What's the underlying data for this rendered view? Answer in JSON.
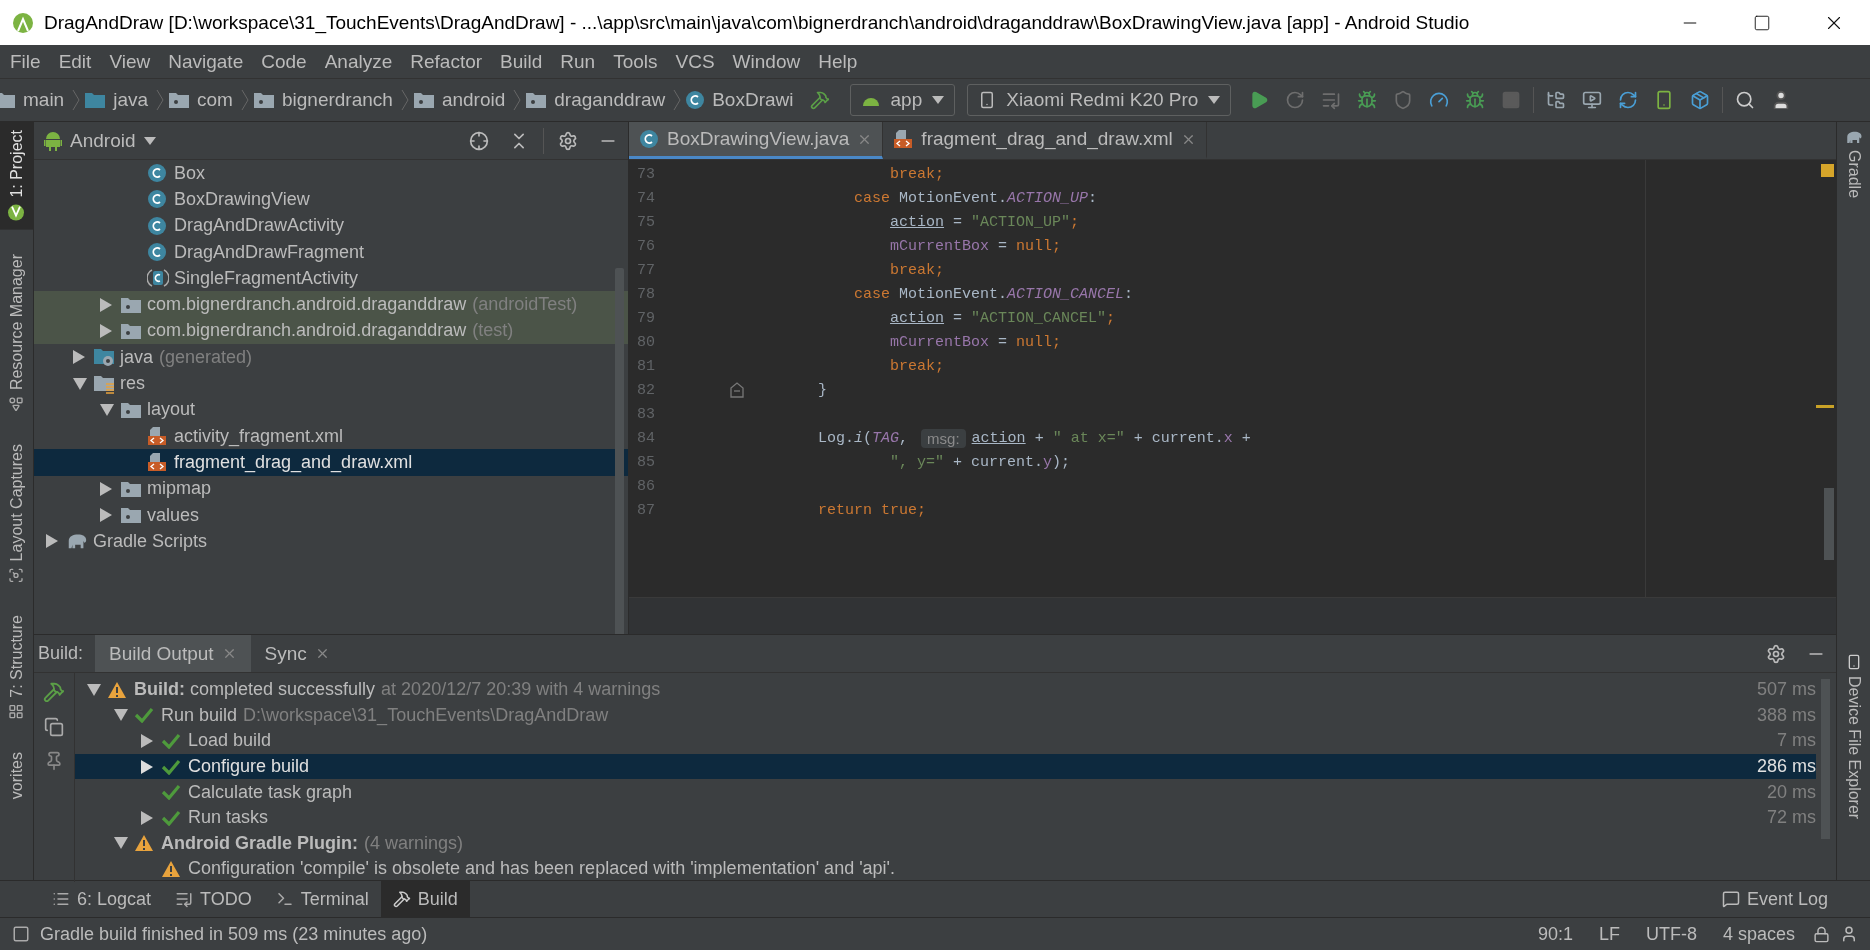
{
  "window": {
    "title": "DragAndDraw [D:\\workspace\\31_TouchEvents\\DragAndDraw] - ...\\app\\src\\main\\java\\com\\bignerdranch\\android\\draganddraw\\BoxDrawingView.java [app] - Android Studio"
  },
  "menu": [
    "File",
    "Edit",
    "View",
    "Navigate",
    "Code",
    "Analyze",
    "Refactor",
    "Build",
    "Run",
    "Tools",
    "VCS",
    "Window",
    "Help"
  ],
  "breadcrumbs": [
    {
      "label": "main",
      "kind": "folder"
    },
    {
      "label": "java",
      "kind": "source-folder"
    },
    {
      "label": "com",
      "kind": "package"
    },
    {
      "label": "bignerdranch",
      "kind": "package"
    },
    {
      "label": "android",
      "kind": "package"
    },
    {
      "label": "draganddraw",
      "kind": "package"
    },
    {
      "label": "BoxDrawi",
      "kind": "class"
    }
  ],
  "toolbar": {
    "run_config": "app",
    "device": "Xiaomi Redmi K20 Pro"
  },
  "left_tool_tabs": [
    {
      "label": "1: Project",
      "kind": "project",
      "selected": true
    },
    {
      "label": "Resource Manager",
      "kind": "resources",
      "selected": false
    },
    {
      "label": "Layout Captures",
      "kind": "captures",
      "selected": false
    },
    {
      "label": "7: Structure",
      "kind": "structure",
      "selected": false
    },
    {
      "label": "vorites",
      "kind": "favorites",
      "selected": false
    }
  ],
  "right_tool_tabs": [
    {
      "label": "Gradle",
      "kind": "gradle"
    },
    {
      "label": "Device File Explorer",
      "kind": "device"
    }
  ],
  "project": {
    "view": "Android",
    "tree": [
      {
        "children": [
          {
            "children": [
              {
                "children": [
                  {
                    "label": "Box",
                    "kind": "class",
                    "selected": false
                  },
                  {
                    "label": "BoxDrawingView",
                    "kind": "class",
                    "selected": false
                  },
                  {
                    "label": "DragAndDrawActivity",
                    "kind": "class",
                    "selected": false
                  },
                  {
                    "label": "DragAndDrawFragment",
                    "kind": "class",
                    "selected": false
                  },
                  {
                    "label": "SingleFragmentActivity",
                    "kind": "abstract-class",
                    "selected": false
                  }
                ]
              },
              {
                "label": "com.bignerdranch.android.draganddraw",
                "note": "(androidTest)",
                "kind": "package",
                "expanded": false,
                "test": true,
                "selected": false
              },
              {
                "label": "com.bignerdranch.android.draganddraw",
                "note": "(test)",
                "kind": "package",
                "expanded": false,
                "test": true,
                "selected": false
              }
            ]
          },
          {
            "label": "java",
            "note": "(generated)",
            "kind": "generated-folder",
            "expanded": false,
            "selected": false
          },
          {
            "label": "res",
            "kind": "res-folder",
            "expanded": true,
            "selected": false,
            "children": [
              {
                "label": "layout",
                "kind": "package",
                "expanded": true,
                "selected": false,
                "children": [
                  {
                    "label": "activity_fragment.xml",
                    "kind": "layout-file",
                    "selected": false
                  },
                  {
                    "label": "fragment_drag_and_draw.xml",
                    "kind": "layout-file",
                    "selected": true
                  }
                ]
              },
              {
                "label": "mipmap",
                "kind": "package",
                "expanded": false,
                "selected": false
              },
              {
                "label": "values",
                "kind": "package",
                "expanded": false,
                "selected": false
              }
            ]
          }
        ]
      },
      {
        "label": "Gradle Scripts",
        "kind": "gradle",
        "expanded": false,
        "selected": false
      }
    ]
  },
  "editor": {
    "tabs": [
      {
        "label": "BoxDrawingView.java",
        "kind": "class",
        "selected": true
      },
      {
        "label": "fragment_drag_and_draw.xml",
        "kind": "layout-file",
        "selected": false
      }
    ],
    "lines": [
      {
        "number": "73",
        "tokens": [
          {
            "kind": "keyword",
            "text": "            break;"
          }
        ]
      },
      {
        "number": "74",
        "tokens": [
          {
            "kind": "keyword",
            "text": "        case"
          },
          {
            "kind": "plain",
            "text": " MotionEvent."
          },
          {
            "kind": "constant",
            "text": "ACTION_UP"
          },
          {
            "kind": "plain",
            "text": ":"
          }
        ]
      },
      {
        "number": "75",
        "tokens": [
          {
            "kind": "variable",
            "text": "            action"
          },
          {
            "kind": "plain",
            "text": " = "
          },
          {
            "kind": "string",
            "text": "\"ACTION_UP\""
          },
          {
            "kind": "keyword",
            "text": ";"
          }
        ]
      },
      {
        "number": "76",
        "tokens": [
          {
            "kind": "field",
            "text": "            mCurrentBox"
          },
          {
            "kind": "plain",
            "text": " = "
          },
          {
            "kind": "keyword",
            "text": "null;"
          }
        ]
      },
      {
        "number": "77",
        "tokens": [
          {
            "kind": "keyword",
            "text": "            break;"
          }
        ]
      },
      {
        "number": "78",
        "tokens": [
          {
            "kind": "keyword",
            "text": "        case"
          },
          {
            "kind": "plain",
            "text": " MotionEvent."
          },
          {
            "kind": "constant",
            "text": "ACTION_CANCEL"
          },
          {
            "kind": "plain",
            "text": ":"
          }
        ]
      },
      {
        "number": "79",
        "tokens": [
          {
            "kind": "variable",
            "text": "            action"
          },
          {
            "kind": "plain",
            "text": " = "
          },
          {
            "kind": "string",
            "text": "\"ACTION_CANCEL\""
          },
          {
            "kind": "keyword",
            "text": ";"
          }
        ]
      },
      {
        "number": "80",
        "tokens": [
          {
            "kind": "field",
            "text": "            mCurrentBox"
          },
          {
            "kind": "plain",
            "text": " = "
          },
          {
            "kind": "keyword",
            "text": "null;"
          }
        ]
      },
      {
        "number": "81",
        "tokens": [
          {
            "kind": "keyword",
            "text": "            break;"
          }
        ]
      },
      {
        "number": "82",
        "fold": true,
        "tokens": [
          {
            "kind": "plain",
            "text": "    }"
          }
        ]
      },
      {
        "number": "83"
      },
      {
        "number": "84",
        "tokens": [
          {
            "kind": "plain",
            "text": "    Log."
          },
          {
            "kind": "static",
            "text": "i"
          },
          {
            "kind": "plain",
            "text": "("
          },
          {
            "kind": "constant",
            "text": "TAG"
          },
          {
            "kind": "plain",
            "text": ", "
          },
          {
            "kind": "hint",
            "text": "msg:"
          },
          {
            "kind": "variable",
            "text": "action"
          },
          {
            "kind": "plain",
            "text": " + "
          },
          {
            "kind": "string",
            "text": "\" at x=\""
          },
          {
            "kind": "plain",
            "text": " + current."
          },
          {
            "kind": "field",
            "text": "x"
          },
          {
            "kind": "plain",
            "text": " +"
          }
        ]
      },
      {
        "number": "85",
        "tokens": [
          {
            "kind": "string",
            "text": "            \", y=\""
          },
          {
            "kind": "plain",
            "text": " + current."
          },
          {
            "kind": "field",
            "text": "y"
          },
          {
            "kind": "plain",
            "text": ");"
          }
        ]
      },
      {
        "number": "86"
      },
      {
        "number": "87",
        "tokens": [
          {
            "kind": "keyword",
            "text": "    return true;"
          }
        ]
      }
    ]
  },
  "build": {
    "title": "Build:",
    "tabs": [
      {
        "label": "Build Output",
        "selected": true
      },
      {
        "label": "Sync",
        "selected": false
      }
    ],
    "tree": [
      {
        "label": "**Build:** completed successfully",
        "note": "at 2020/12/7 20:39  with 4 warnings",
        "kind": "warning",
        "expanded": true,
        "bold": false,
        "selected": false,
        "duration": "507 ms",
        "children": [
          {
            "label": "Run build",
            "note": "D:\\workspace\\31_TouchEvents\\DragAndDraw",
            "kind": "success",
            "expanded": true,
            "bold": false,
            "selected": false,
            "duration": "388 ms",
            "children": [
              {
                "label": "Load build",
                "kind": "success",
                "expanded": false,
                "bold": false,
                "selected": false,
                "duration": "7 ms"
              },
              {
                "label": "Configure build",
                "kind": "success",
                "expanded": false,
                "bold": false,
                "selected": true,
                "duration": "286 ms"
              },
              {
                "label": "Calculate task graph",
                "kind": "success",
                "bold": false,
                "selected": false,
                "duration": "20 ms"
              },
              {
                "label": "Run tasks",
                "kind": "success",
                "expanded": false,
                "bold": false,
                "selected": false,
                "duration": "72 ms"
              }
            ]
          },
          {
            "label": "Android Gradle Plugin:",
            "note": "(4 warnings)",
            "kind": "warning",
            "expanded": true,
            "bold": true,
            "selected": false,
            "children": [
              {
                "label": "Configuration 'compile' is obsolete and has been replaced with 'implementation' and 'api'.",
                "kind": "warning",
                "bold": false,
                "selected": false
              }
            ]
          }
        ]
      }
    ]
  },
  "bottom_tabs": [
    {
      "label": "6: Logcat",
      "kind": "logcat",
      "selected": false
    },
    {
      "label": "TODO",
      "kind": "todo",
      "selected": false
    },
    {
      "label": "Terminal",
      "kind": "terminal",
      "selected": false
    },
    {
      "label": "Build",
      "kind": "build",
      "selected": true
    }
  ],
  "event_log": "Event Log",
  "status_bar": {
    "message": "Gradle build finished in 509 ms (23 minutes ago)",
    "position": "90:1",
    "line_ending": "LF",
    "encoding": "UTF-8",
    "indent": "4 spaces"
  }
}
